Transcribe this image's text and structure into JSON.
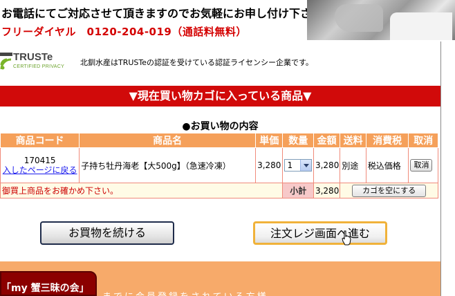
{
  "header": {
    "phone_line1": "お電話にてご対応させて頂きますのでお気軽にお申し付け下さい。",
    "phone_line2": "フリーダイヤル　0120-204-019（通話料無料）"
  },
  "truste": {
    "logo_name": "TRUSTe",
    "logo_sub": "CERTIFIED PRIVACY",
    "text": "北釧水産はTRUSTeの認証を受けている認証ライセンシー企業です。"
  },
  "banner": {
    "text": "▼現在買い物カゴに入っている商品▼"
  },
  "section_title": "●お買い物の内容",
  "cart": {
    "headers": [
      "商品コード",
      "商品名",
      "単価",
      "数量",
      "金額",
      "送料",
      "消費税",
      "取消"
    ],
    "item": {
      "code": "170415",
      "back_link": "入したページに戻る",
      "name": "子持ち牡丹海老【大500g】（急速冷凍）",
      "unit_price": "3,280",
      "quantity": "1",
      "amount": "3,280",
      "shipping": "別途",
      "tax": "税込価格",
      "cancel_label": "取消"
    },
    "footer": {
      "note": "御買上商品をお確かめ下さい。",
      "subtotal_label": "小計",
      "subtotal_value": "3,280",
      "empty_cart_label": "カゴを空にする"
    }
  },
  "buttons": {
    "continue_label": "お買物を続ける",
    "checkout_label": "注文レジ画面へ進む"
  },
  "club": {
    "label": "「my 蟹三昧の会」",
    "text": "までに会員登録をされている方様"
  },
  "colors": {
    "banner_red": "#d10a0a",
    "header_orange": "#f5a05a",
    "phone_red": "#d40000",
    "club_orange": "#f7aa6a"
  }
}
